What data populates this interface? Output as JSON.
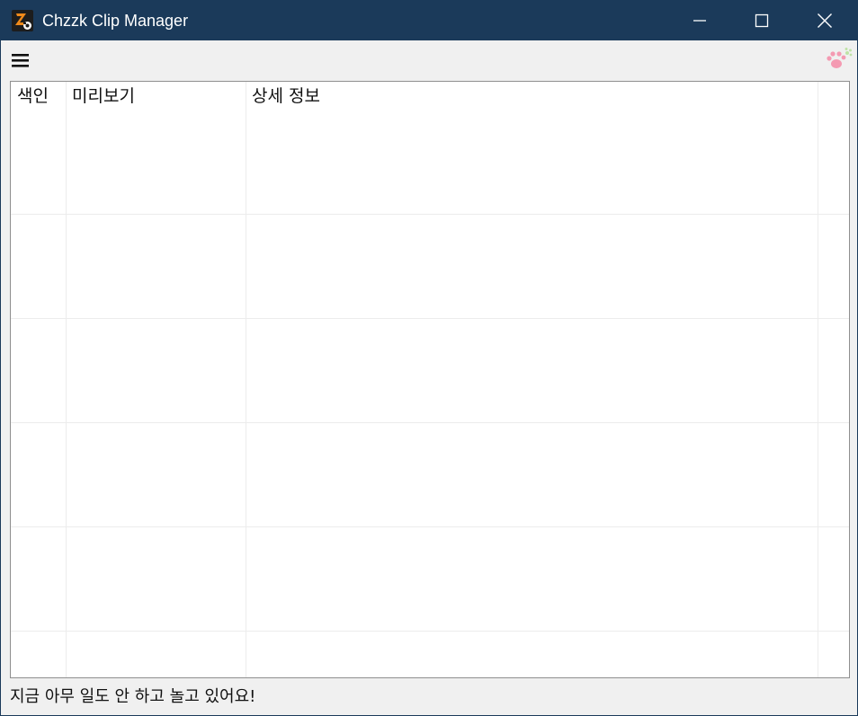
{
  "window": {
    "title": "Chzzk Clip Manager",
    "title_bar_color": "#1b3a5a"
  },
  "window_controls": {
    "minimize": "minimize-icon",
    "maximize": "maximize-icon",
    "close": "close-icon"
  },
  "toolbar": {
    "menu_icon": "hamburger-menu-icon",
    "logo_icon": "paw-icon"
  },
  "grid": {
    "columns": [
      "색인",
      "미리보기",
      "상세 정보",
      ""
    ],
    "row_count": 6
  },
  "status": {
    "text": "지금 아무 일도 안 하고 놀고 있어요!"
  }
}
